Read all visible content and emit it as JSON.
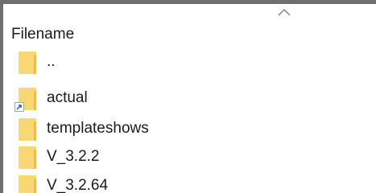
{
  "file_list": {
    "column_header": "Filename",
    "sort_indicator_icon": "chevron-up-icon",
    "rows": [
      {
        "name": "..",
        "icon": "folder-icon",
        "shortcut": false
      },
      {
        "name": "actual",
        "icon": "folder-icon",
        "shortcut": true
      },
      {
        "name": "templateshows",
        "icon": "folder-icon",
        "shortcut": false
      },
      {
        "name": "V_3.2.2",
        "icon": "folder-icon",
        "shortcut": false
      },
      {
        "name": "V_3.2.64",
        "icon": "folder-icon",
        "shortcut": false
      }
    ]
  },
  "colors": {
    "folder": "#f8d775",
    "folder_edge": "#e9bf4a",
    "frame_border": "#6f6f6f",
    "shortcut_arrow": "#1f5fbf"
  }
}
